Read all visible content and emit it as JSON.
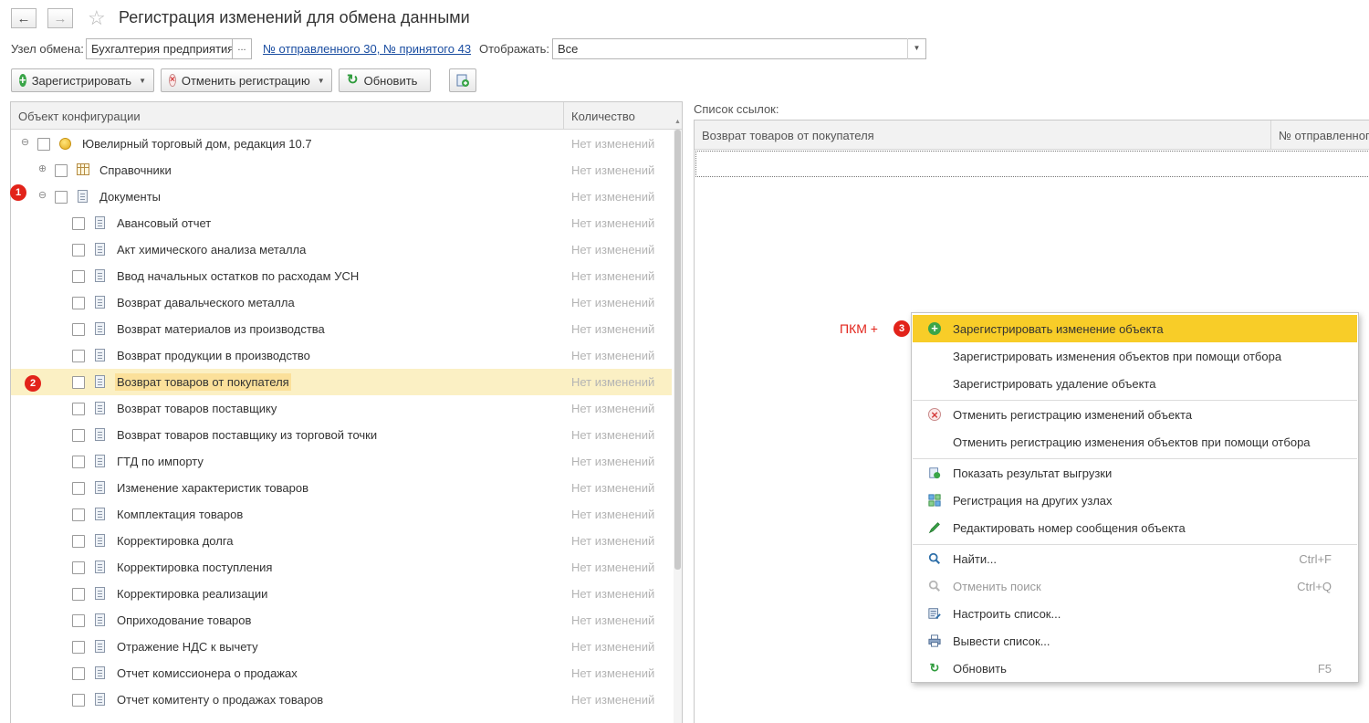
{
  "header": {
    "back_icon": "←",
    "forward_icon": "→",
    "star_icon": "☆",
    "title": "Регистрация изменений для обмена данными"
  },
  "filters": {
    "node_label": "Узел обмена:",
    "node_value": "Бухгалтерия предприятия",
    "node_select": "...",
    "sent_received_link": "№ отправленного 30, № принятого 43",
    "display_label": "Отображать:",
    "display_value": "Все"
  },
  "toolbar": {
    "register_label": "Зарегистрировать",
    "cancel_label": "Отменить регистрацию",
    "refresh_label": "Обновить"
  },
  "tree": {
    "col_object": "Объект конфигурации",
    "col_count": "Количество",
    "rows": [
      {
        "name": "Ювелирный торговый дом, редакция 10.7",
        "count": "Нет изменений"
      },
      {
        "name": "Справочники",
        "count": "Нет изменений"
      },
      {
        "name": "Документы",
        "count": "Нет изменений"
      },
      {
        "name": "Авансовый отчет",
        "count": "Нет изменений"
      },
      {
        "name": "Акт химического анализа металла",
        "count": "Нет изменений"
      },
      {
        "name": "Ввод начальных остатков по расходам УСН",
        "count": "Нет изменений"
      },
      {
        "name": "Возврат давальческого металла",
        "count": "Нет изменений"
      },
      {
        "name": "Возврат материалов из производства",
        "count": "Нет изменений"
      },
      {
        "name": "Возврат продукции в производство",
        "count": "Нет изменений"
      },
      {
        "name": "Возврат товаров от покупателя",
        "count": "Нет изменений"
      },
      {
        "name": "Возврат товаров поставщику",
        "count": "Нет изменений"
      },
      {
        "name": "Возврат товаров поставщику из торговой точки",
        "count": "Нет изменений"
      },
      {
        "name": "ГТД по импорту",
        "count": "Нет изменений"
      },
      {
        "name": "Изменение характеристик товаров",
        "count": "Нет изменений"
      },
      {
        "name": "Комплектация товаров",
        "count": "Нет изменений"
      },
      {
        "name": "Корректировка долга",
        "count": "Нет изменений"
      },
      {
        "name": "Корректировка поступления",
        "count": "Нет изменений"
      },
      {
        "name": "Корректировка реализации",
        "count": "Нет изменений"
      },
      {
        "name": "Оприходование товаров",
        "count": "Нет изменений"
      },
      {
        "name": "Отражение НДС к вычету",
        "count": "Нет изменений"
      },
      {
        "name": "Отчет комиссионера о продажах",
        "count": "Нет изменений"
      },
      {
        "name": "Отчет комитенту о продажах товаров",
        "count": "Нет изменений"
      }
    ]
  },
  "markers": {
    "m1": "1",
    "m2": "2",
    "m3": "3"
  },
  "refs": {
    "label": "Список ссылок:",
    "col1": "Возврат товаров от покупателя",
    "col2": "№ отправленного"
  },
  "annotation": "ПКМ +",
  "menu": {
    "items": [
      {
        "label": "Зарегистрировать изменение объекта",
        "shortcut": ""
      },
      {
        "label": "Зарегистрировать изменения объектов при помощи отбора",
        "shortcut": ""
      },
      {
        "label": "Зарегистрировать удаление объекта",
        "shortcut": ""
      },
      {
        "label": "Отменить регистрацию изменений объекта",
        "shortcut": ""
      },
      {
        "label": "Отменить регистрацию изменения объектов при помощи отбора",
        "shortcut": ""
      },
      {
        "label": "Показать результат выгрузки",
        "shortcut": ""
      },
      {
        "label": "Регистрация на других узлах",
        "shortcut": ""
      },
      {
        "label": "Редактировать номер сообщения объекта",
        "shortcut": ""
      },
      {
        "label": "Найти...",
        "shortcut": "Ctrl+F"
      },
      {
        "label": "Отменить поиск",
        "shortcut": "Ctrl+Q"
      },
      {
        "label": "Настроить список...",
        "shortcut": ""
      },
      {
        "label": "Вывести список...",
        "shortcut": ""
      },
      {
        "label": "Обновить",
        "shortcut": "F5"
      }
    ]
  },
  "colors": {
    "highlight": "#f8cd28",
    "selected_row": "#fbf0c4",
    "marker": "#e2231a",
    "link": "#1a4da1"
  }
}
